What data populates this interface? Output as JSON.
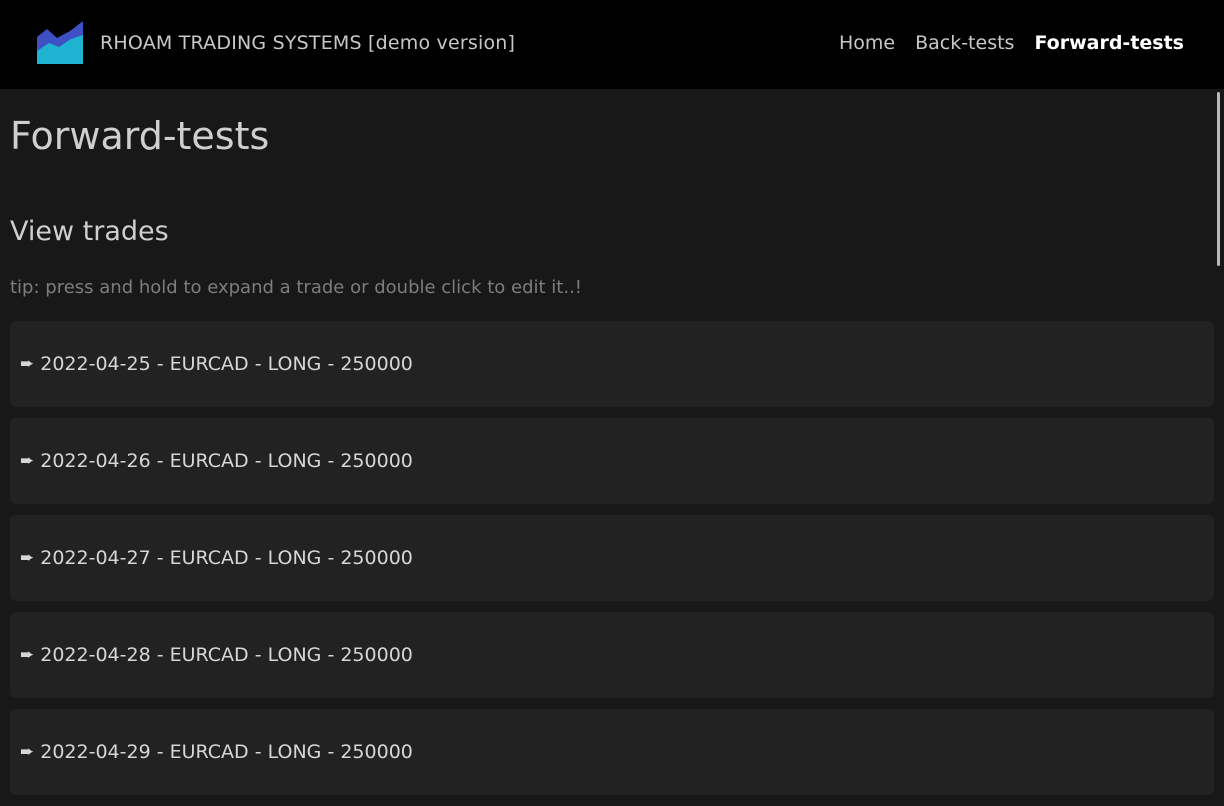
{
  "header": {
    "brand": "RHOAM TRADING SYSTEMS [demo version]",
    "logo_icon": "area-chart-logo",
    "nav": [
      {
        "label": "Home",
        "active": false
      },
      {
        "label": "Back-tests",
        "active": false
      },
      {
        "label": "Forward-tests",
        "active": true
      }
    ]
  },
  "main": {
    "title": "Forward-tests",
    "section_title": "View trades",
    "tip": "tip: press and hold to expand a trade or double click to edit it..!",
    "trade_icon": "arrow-right-icon",
    "trade_arrow_glyph": "➨",
    "trades": [
      {
        "label": "2022-04-25 - EURCAD - LONG - 250000"
      },
      {
        "label": "2022-04-26 - EURCAD - LONG - 250000"
      },
      {
        "label": "2022-04-27 - EURCAD - LONG - 250000"
      },
      {
        "label": "2022-04-28 - EURCAD - LONG - 250000"
      },
      {
        "label": "2022-04-29 - EURCAD - LONG - 250000"
      }
    ]
  },
  "colors": {
    "header_bg": "#000000",
    "page_bg": "#181818",
    "card_bg": "#222222",
    "logo_top": "#3f4fc4",
    "logo_bottom": "#1fb3d2"
  }
}
